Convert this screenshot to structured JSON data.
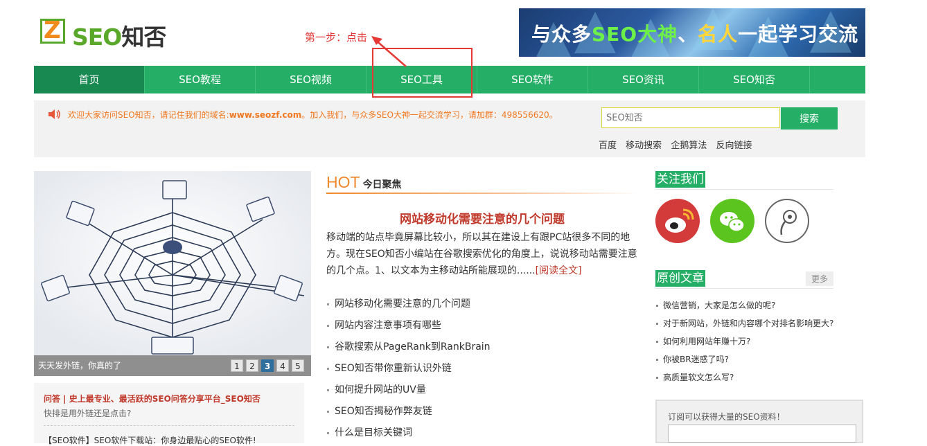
{
  "logo": {
    "mark": "Z",
    "text_en": "SEO",
    "text_cn": "知否"
  },
  "annotation": {
    "text": "第一步：点击"
  },
  "banner": {
    "part1": "与众多",
    "part2": "SEO大神",
    "part3": "、",
    "part4": "名人",
    "part5": "一起学习交流"
  },
  "nav": [
    {
      "label": "首页"
    },
    {
      "label": "SEO教程"
    },
    {
      "label": "SEO视频"
    },
    {
      "label": "SEO工具"
    },
    {
      "label": "SEO软件"
    },
    {
      "label": "SEO资讯"
    },
    {
      "label": "SEO知否"
    }
  ],
  "notice": {
    "prefix": "欢迎大家访问SEO知否，请记住我们的域名:",
    "domain": "www.seozf.com",
    "suffix": "。加入我们，与众多SEO大神一起交流学习，请加群：498556620。"
  },
  "search": {
    "placeholder": "SEO知否",
    "button": "搜索"
  },
  "quick_links": [
    "百度",
    "移动搜索",
    "企鹅算法",
    "反向链接"
  ],
  "slider": {
    "caption": "天天发外链，你真的了",
    "pages": [
      "1",
      "2",
      "3",
      "4",
      "5"
    ],
    "active_page": "3"
  },
  "qa": {
    "title": "问答 | 史上最专业、最活跃的SEO问答分享平台_SEO知否",
    "subtitle": "快排是用外链还是点击?",
    "line2": "【SEO软件】SEO软件下载站：你身边最贴心的SEO软件!"
  },
  "hot": {
    "label": "HOT",
    "sub": "今日聚焦"
  },
  "headline": "网站移动化需要注意的几个问题",
  "summary": {
    "text": "移动端的站点毕竟屏幕比较小，所以其在建设上有跟PC站很多不同的地方。现在SEO知否小编站在谷歌搜索优化的角度上，说说移动站需要注意的几个点。1、以文本为主移动站所能展现的......",
    "more": "[阅读全文]"
  },
  "news": [
    "网站移动化需要注意的几个问题",
    "网站内容注意事项有哪些",
    "谷歌搜索从PageRank到RankBrain",
    "SEO知否带你重新认识外链",
    "如何提升网站的UV量",
    "SEO知否揭秘作弊友链",
    "什么是目标关键词"
  ],
  "follow": {
    "title": "关注我们"
  },
  "original": {
    "title": "原创文章",
    "more": "更多",
    "items": [
      "微信营销，大家是怎么做的呢?",
      "对于新网站，外链和内容哪个对排名影响更大?",
      "如何利用网站年赚十万?",
      "你被BR迷惑了吗?",
      "高质量软文怎么写?"
    ]
  },
  "subscribe": {
    "text": "订阅可以获得大量的SEO资料！"
  },
  "colors": {
    "brand_green": "#25ae66",
    "nav_active": "#188a51",
    "accent_red": "#c0392b",
    "notice_orange": "#f07820"
  }
}
